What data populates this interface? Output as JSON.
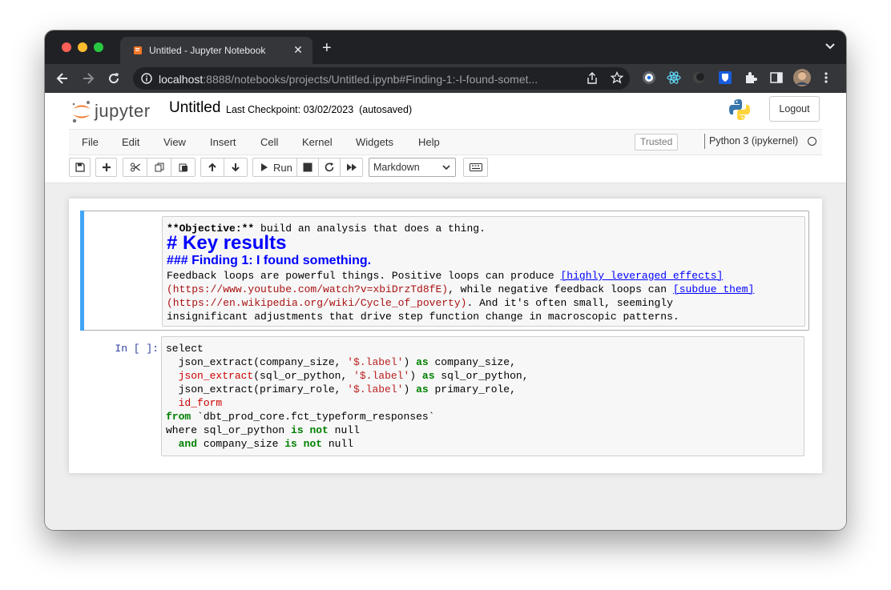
{
  "browser": {
    "tab_title": "Untitled - Jupyter Notebook",
    "url_host": "localhost",
    "url_rest": ":8888/notebooks/projects/Untitled.ipynb#Finding-1:-I-found-somet..."
  },
  "header": {
    "logo_text": "jupyter",
    "notebook_name": "Untitled",
    "checkpoint": "Last Checkpoint: 03/02/2023",
    "autosave": "(autosaved)",
    "logout_label": "Logout"
  },
  "menu": {
    "items": [
      "File",
      "Edit",
      "View",
      "Insert",
      "Cell",
      "Kernel",
      "Widgets",
      "Help"
    ],
    "trusted_label": "Trusted",
    "kernel_name": "Python 3 (ipykernel)"
  },
  "toolbar": {
    "run_label": "Run",
    "cell_type": "Markdown"
  },
  "markdown_cell": {
    "line1_bold": "**Objective:**",
    "line1_rest": " build an analysis that does a thing.",
    "heading1": "# Key results",
    "heading3": "### Finding 1: I found something.",
    "p1_pre": "Feedback loops are powerful things. Positive loops can produce ",
    "link1_text": "[highly leveraged effects]",
    "link1_url": "(https://www.youtube.com/watch?v=xbiDrzTd8fE)",
    "p2_mid": ", while negative feedback loops can ",
    "link2_text": "[subdue them]",
    "link2_url": "(https://en.wikipedia.org/wiki/Cycle_of_poverty)",
    "p3_rest": ". And it's often small, seemingly",
    "p4": "insignificant adjustments that drive step function change in macroscopic patterns."
  },
  "code_cell": {
    "prompt": "In [ ]:",
    "l1": "select",
    "l2_a": "  json_extract(company_size, ",
    "l2_str": "'$.label'",
    "l2_b": ") ",
    "l2_kw": "as",
    "l2_c": " company_size,",
    "l3_indent": "  ",
    "l3_fn": "json_extract",
    "l3_a": "(sql_or_python, ",
    "l3_str": "'$.label'",
    "l3_b": ") ",
    "l3_kw": "as",
    "l3_c": " sql_or_python,",
    "l4_a": "  json_extract(primary_role, ",
    "l4_str": "'$.label'",
    "l4_b": ") ",
    "l4_kw": "as",
    "l4_c": " primary_role,",
    "l5_indent": "  ",
    "l5_fn": "id_form",
    "l6_kw": "from",
    "l6_a": " `dbt_prod_core.fct_typeform_responses`",
    "l7_a": "where sql_or_python ",
    "l7_kw1": "is",
    "l7_sp": " ",
    "l7_kw2": "not",
    "l7_b": " null",
    "l8_indent": "  ",
    "l8_kw1": "and",
    "l8_a": " company_size ",
    "l8_kw2": "is",
    "l8_sp": " ",
    "l8_kw3": "not",
    "l8_b": " null"
  },
  "icons": [
    "book-icon",
    "close-icon",
    "plus-icon",
    "chevron-down-icon",
    "back-arrow-icon",
    "forward-arrow-icon",
    "reload-icon",
    "info-icon",
    "share-icon",
    "star-icon",
    "python-logo",
    "save-icon",
    "add-cell-icon",
    "cut-icon",
    "copy-icon",
    "paste-icon",
    "move-up-icon",
    "move-down-icon",
    "run-icon",
    "stop-icon",
    "restart-icon",
    "fast-forward-icon",
    "keyboard-icon"
  ],
  "colors": {
    "accent_blue": "#42a5f5",
    "heading_blue": "#0000ff",
    "keyword_green": "#008000",
    "string_red": "#ba2121",
    "prompt_blue": "#303f9f"
  }
}
